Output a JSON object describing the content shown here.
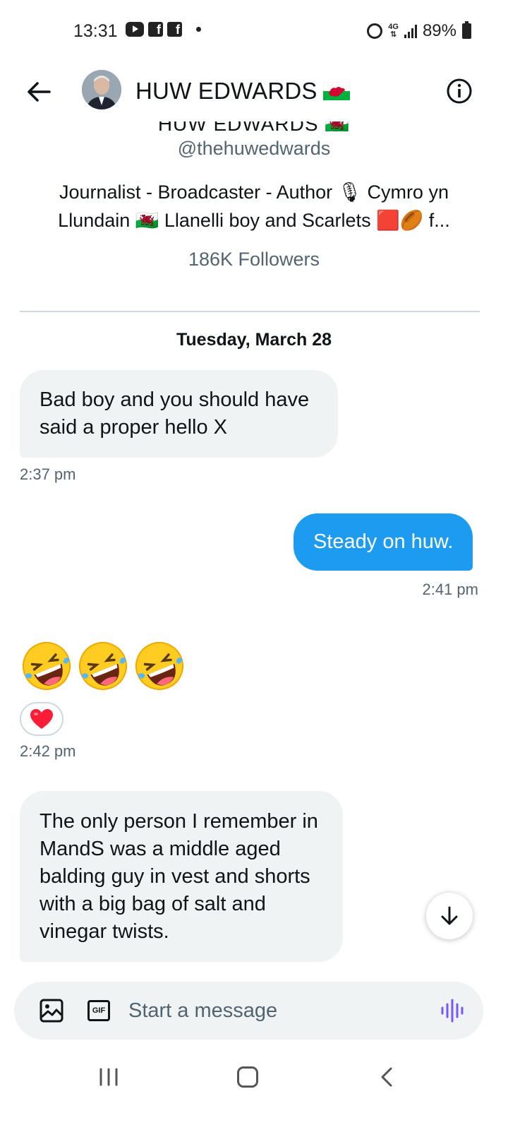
{
  "status_bar": {
    "time": "13:31",
    "notification_icons": [
      "youtube-icon",
      "facebook-icon",
      "facebook-icon"
    ],
    "network": "4G",
    "battery": "89%"
  },
  "header": {
    "name": "HUW EDWARDS",
    "flag": "🏴󠁧󠁢󠁷󠁬󠁳󠁿"
  },
  "profile": {
    "cut_name": "HUW EDWARDS 🏴󠁧󠁢󠁷󠁬󠁳󠁿",
    "handle": "@thehuwedwards",
    "bio_line1": "Journalist - Broadcaster - Author 🎙 Cymro yn",
    "bio_line2": "Llundain 🏴󠁧󠁢󠁷󠁬󠁳󠁿 Llanelli boy and Scarlets 🟥🏉 f...",
    "followers": "186K Followers"
  },
  "conversation": {
    "date": "Tuesday, March 28",
    "messages": [
      {
        "direction": "in",
        "text": "Bad boy and you should have said a proper hello X",
        "time": "2:37 pm"
      },
      {
        "direction": "out",
        "text": "Steady on huw.",
        "time": "2:41 pm"
      },
      {
        "direction": "in",
        "text": "🤣🤣🤣",
        "reaction": "❤️",
        "time": "2:42 pm"
      },
      {
        "direction": "in",
        "text": "The only person I remember in MandS was a middle aged balding guy in vest and shorts with a big bag of salt and vinegar twists."
      }
    ]
  },
  "composer": {
    "placeholder": "Start a message",
    "gif_label": "GIF"
  },
  "colors": {
    "accent": "#1d9bf0",
    "incoming_bubble": "#eff3f4",
    "secondary_text": "#536471",
    "voice_icon": "#7856ff"
  }
}
